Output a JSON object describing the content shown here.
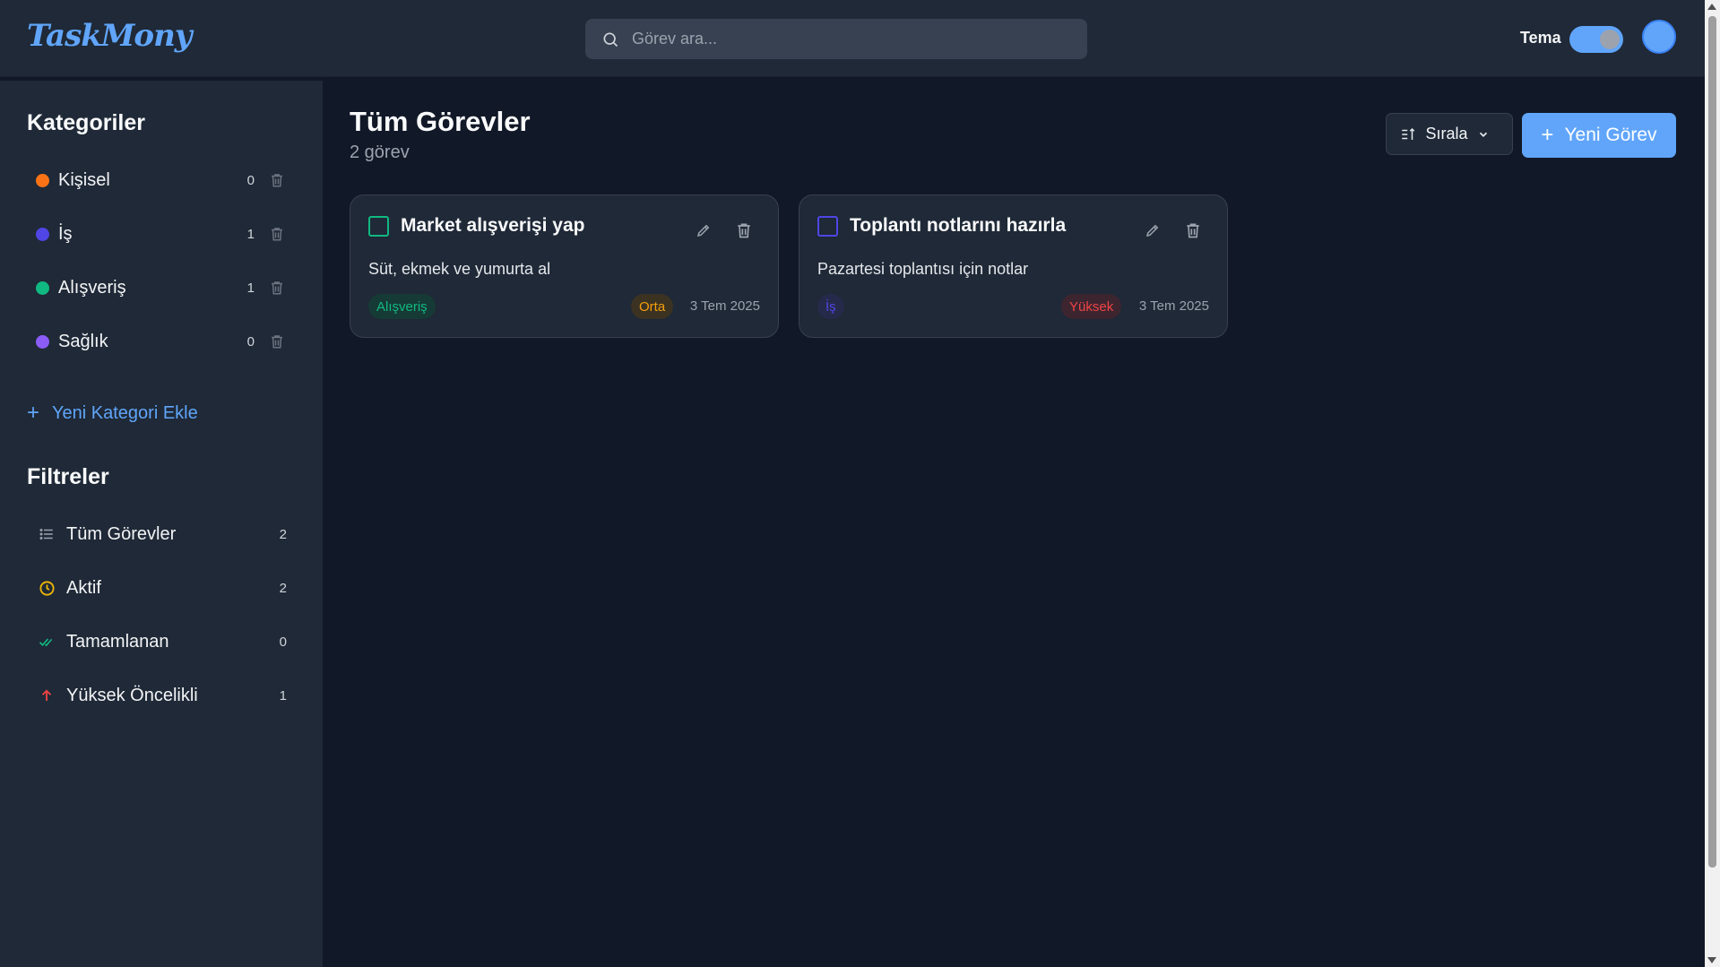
{
  "app": {
    "logo": "TaskMony"
  },
  "header": {
    "search_placeholder": "Görev ara...",
    "theme_label": "Tema"
  },
  "sidebar": {
    "categories_title": "Kategoriler",
    "categories": [
      {
        "label": "Kişisel",
        "count": "0",
        "color": "#f97316"
      },
      {
        "label": "İş",
        "count": "1",
        "color": "#4f46e5"
      },
      {
        "label": "Alışveriş",
        "count": "1",
        "color": "#10b981"
      },
      {
        "label": "Sağlık",
        "count": "0",
        "color": "#8b5cf6"
      }
    ],
    "add_category": "Yeni Kategori Ekle",
    "filters_title": "Filtreler",
    "filters": [
      {
        "label": "Tüm Görevler",
        "count": "2",
        "icon": "list-icon"
      },
      {
        "label": "Aktif",
        "count": "2",
        "icon": "clock-icon"
      },
      {
        "label": "Tamamlanan",
        "count": "0",
        "icon": "double-check-icon"
      },
      {
        "label": "Yüksek Öncelikli",
        "count": "1",
        "icon": "arrow-up-icon"
      }
    ]
  },
  "main": {
    "title": "Tüm Görevler",
    "subtitle": "2 görev",
    "sort_label": "Sırala",
    "new_task_label": "Yeni Görev"
  },
  "tasks": [
    {
      "title": "Market alışverişi yap",
      "description": "Süt, ekmek ve yumurta al",
      "category": "Alışveriş",
      "category_color": "#10b981",
      "priority": "Orta",
      "priority_color": "#f59e0b",
      "date": "3 Tem 2025"
    },
    {
      "title": "Toplantı notlarını hazırla",
      "description": "Pazartesi toplantısı için notlar",
      "category": "İş",
      "category_color": "#4f46e5",
      "priority": "Yüksek",
      "priority_color": "#ef4444",
      "date": "3 Tem 2025"
    }
  ],
  "colors": {
    "accent": "#60a5fa",
    "background": "#111827",
    "panel": "#1f2937"
  }
}
